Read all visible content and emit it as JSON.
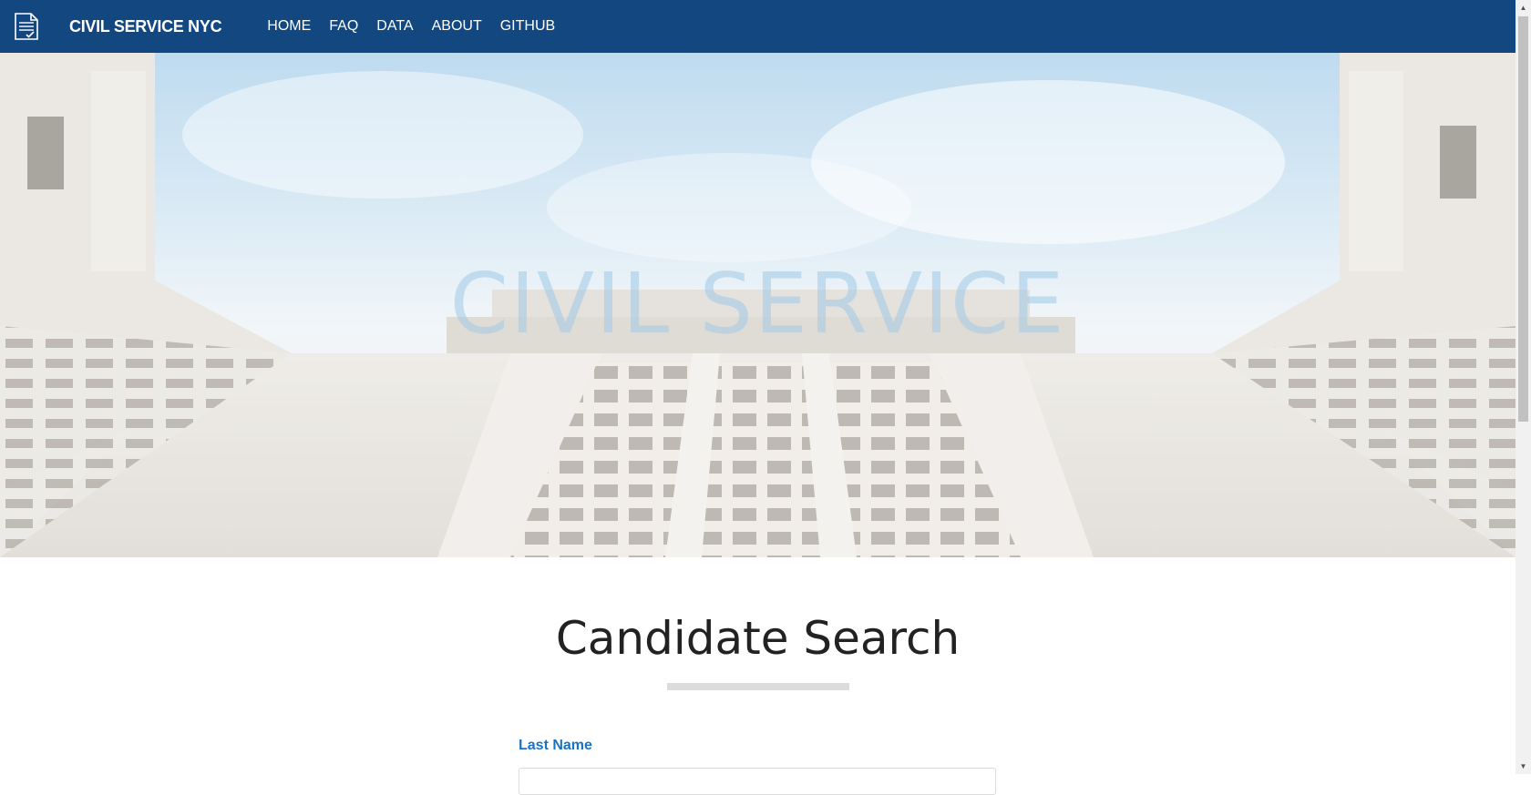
{
  "navbar": {
    "brand": "CIVIL SERVICE NYC",
    "logo_icon": "document-check-icon",
    "links": [
      "HOME",
      "FAQ",
      "DATA",
      "ABOUT",
      "GITHUB"
    ]
  },
  "hero": {
    "title": "CIVIL SERVICE"
  },
  "main": {
    "heading": "Candidate Search",
    "field_label": "Last Name",
    "field_value": ""
  },
  "colors": {
    "navbar_bg": "#134780",
    "label_blue": "#1a73c2"
  }
}
